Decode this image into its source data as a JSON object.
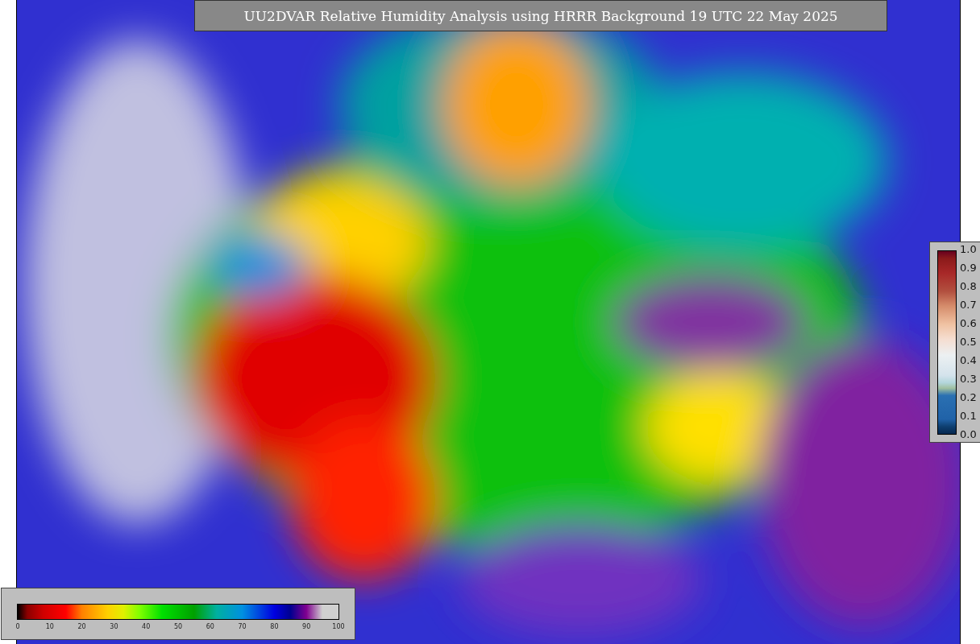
{
  "title": "UU2DVAR Relative Humidity Analysis using HRRR Background 19 UTC 22 May 2025",
  "humidity_scale": {
    "ticks": [
      "0",
      "10",
      "20",
      "30",
      "40",
      "50",
      "60",
      "70",
      "80",
      "90",
      "100"
    ]
  },
  "fraction_scale": {
    "ticks": [
      "1.0",
      "0.9",
      "0.8",
      "0.7",
      "0.6",
      "0.5",
      "0.4",
      "0.3",
      "0.2",
      "0.1",
      "0.0"
    ]
  }
}
